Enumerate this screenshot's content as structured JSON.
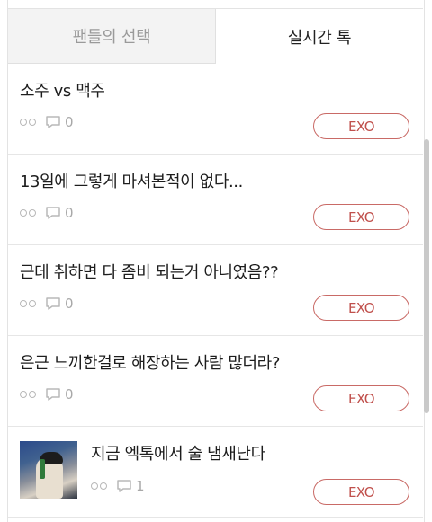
{
  "tabs": [
    {
      "label": "팬들의 선택",
      "active": false
    },
    {
      "label": "실시간 톡",
      "active": true
    }
  ],
  "posts": [
    {
      "title": "소주 vs 맥주",
      "comments": "0",
      "tag": "EXO"
    },
    {
      "title": "13일에 그렇게 마셔본적이 없다...",
      "comments": "0",
      "tag": "EXO"
    },
    {
      "title": "근데 취하면 다 좀비 되는거 아니였음??",
      "comments": "0",
      "tag": "EXO"
    },
    {
      "title": "은근 느끼한걸로 해장하는 사람 많더라?",
      "comments": "0",
      "tag": "EXO"
    },
    {
      "title": "지금 엑톡에서 술 냄새난다",
      "comments": "1",
      "tag": "EXO"
    }
  ],
  "colors": {
    "accent": "#c0504c",
    "tab_inactive_bg": "#f3f3f3"
  },
  "icons": {
    "views": "views-icon",
    "comments": "comment-icon"
  }
}
